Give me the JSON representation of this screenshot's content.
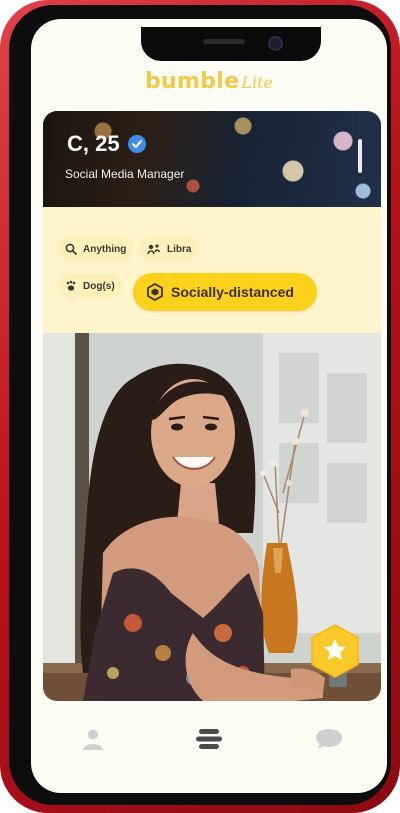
{
  "device": {
    "frame_color": "#c8141c"
  },
  "app": {
    "brand_name": "bumble",
    "brand_suffix": "Lite",
    "brand_color": "#f3c94a"
  },
  "profile": {
    "name_age": "C, 25",
    "job": "Social Media Manager",
    "verified": true,
    "chips": [
      {
        "label": "Anything",
        "icon": "search-icon"
      },
      {
        "label": "Libra",
        "icon": "zodiac-icon"
      },
      {
        "label": "Dog(s)",
        "icon": "dog-icon"
      }
    ],
    "highlight_chip": {
      "label": "Socially-distanced",
      "icon": "hexagon-shield-icon",
      "color": "#fcd11b"
    }
  },
  "actions": {
    "superswipe_icon": "star-icon",
    "superswipe_color": "#f9c829"
  },
  "nav": {
    "items": [
      {
        "name": "profile",
        "icon": "person-icon",
        "active": false
      },
      {
        "name": "discover",
        "icon": "stacked-bars-icon",
        "active": true
      },
      {
        "name": "chats",
        "icon": "chat-bubble-icon",
        "active": false
      }
    ],
    "active_color": "#4a4a4a",
    "inactive_color": "#c7c7c7"
  }
}
